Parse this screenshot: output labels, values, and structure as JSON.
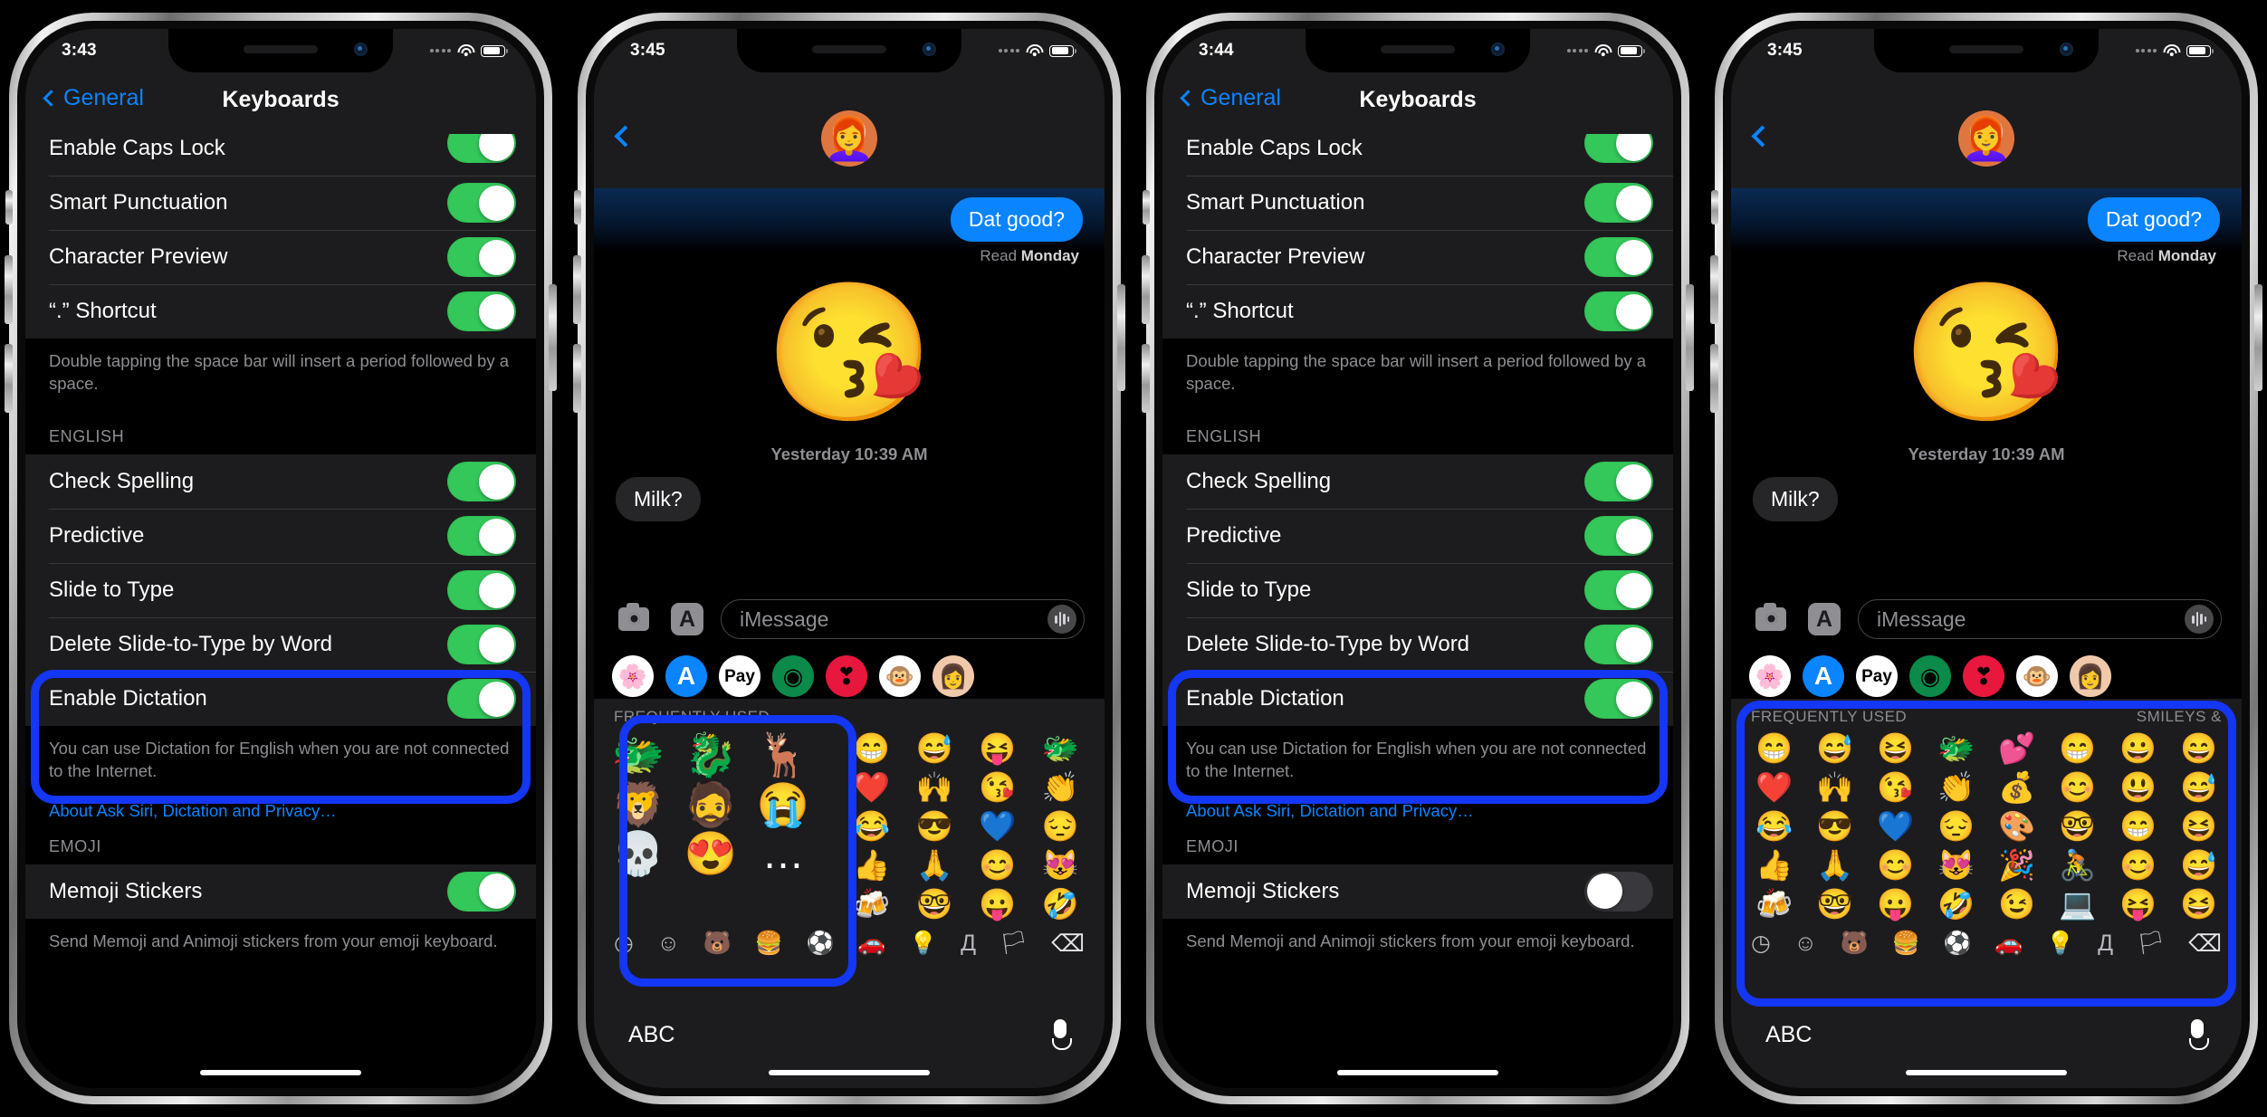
{
  "phones": [
    {
      "id": "phone-settings-on",
      "type": "settings",
      "status": {
        "time": "3:43",
        "signal_dots": 4,
        "wifi": "wifi-icon",
        "battery": "battery-icon"
      },
      "nav": {
        "back_label": "General",
        "title": "Keyboards"
      },
      "rows_top": [
        {
          "label": "Enable Caps Lock",
          "toggle": "on"
        },
        {
          "label": "Smart Punctuation",
          "toggle": "on"
        },
        {
          "label": "Character Preview",
          "toggle": "on"
        },
        {
          "label": "“.” Shortcut",
          "toggle": "on"
        }
      ],
      "footnote_top": "Double tapping the space bar will insert a period followed by a space.",
      "english_header": "ENGLISH",
      "rows_english": [
        {
          "label": "Check Spelling",
          "toggle": "on"
        },
        {
          "label": "Predictive",
          "toggle": "on"
        },
        {
          "label": "Slide to Type",
          "toggle": "on"
        },
        {
          "label": "Delete Slide-to-Type by Word",
          "toggle": "on"
        },
        {
          "label": "Enable Dictation",
          "toggle": "on"
        }
      ],
      "footnote_dictation": "You can use Dictation for English when you are not connected to the Internet.",
      "privacy_link": "About Ask Siri, Dictation and Privacy…",
      "emoji_header": "EMOJI",
      "memoji_row": {
        "label": "Memoji Stickers",
        "toggle": "on"
      },
      "memoji_footnote": "Send Memoji and Animoji stickers from your emoji keyboard.",
      "highlight": true
    },
    {
      "id": "phone-messages-memoji-on",
      "type": "messages",
      "status": {
        "time": "3:45",
        "signal_dots": 4,
        "wifi": "wifi-icon",
        "battery": "battery-icon"
      },
      "nav": {
        "back_icon": "chevron-left-icon",
        "avatar_emoji": "👩‍🦰"
      },
      "thread": [
        {
          "side": "out",
          "text": "Dat good?"
        }
      ],
      "read_prefix": "Read ",
      "read_value": "Monday",
      "sticker_emoji": "😘",
      "daystamp": "Yesterday 10:39 AM",
      "incoming": {
        "side": "in",
        "text": "Milk?"
      },
      "input": {
        "placeholder": "iMessage",
        "camera_icon": "camera-icon",
        "appstore_icon": "app-store-icon",
        "audio_icon": "audio-waveform-icon"
      },
      "app_drawer": [
        "photos-app-icon",
        "app-store-icon",
        "apple-pay-icon",
        "images-app-icon",
        "music-app-icon",
        "animoji-app-icon",
        "memoji-app-icon"
      ],
      "app_drawer_glyphs": [
        "🌺",
        "A",
        " Pay",
        "◉",
        "❣",
        "🐵",
        "👩"
      ],
      "keyboard": {
        "section_left": "FREQUENTLY USED",
        "section_right": "",
        "sticker_highlight": true,
        "stickers": [
          "🐲",
          "🐉",
          "🦌",
          "🦁",
          "🧔",
          "😭",
          "💀",
          "😍",
          "…"
        ],
        "emoji_rows": [
          [
            "😁",
            "😅",
            "😝",
            "🐲"
          ],
          [
            "❤️",
            "🙌",
            "😘",
            "👏"
          ],
          [
            "😂",
            "😎",
            "💙",
            "😔"
          ],
          [
            "👍",
            "🙏",
            "😊",
            "😻"
          ],
          [
            "🍻",
            "🤓",
            "😛",
            "🤣"
          ]
        ],
        "bottom_icons": [
          "recents-icon",
          "smileys-icon",
          "animals-icon",
          "food-icon",
          "activity-icon",
          "travel-icon",
          "objects-icon",
          "symbols-icon",
          "flags-icon",
          "backspace-icon"
        ],
        "bottom_glyphs": [
          "◷",
          "☺",
          "🐻",
          "🍔",
          "⚽",
          "🚗",
          "💡",
          "Д",
          "🏳",
          "⌫"
        ],
        "abc_label": "ABC",
        "mic_icon": "microphone-icon"
      }
    },
    {
      "id": "phone-settings-off",
      "type": "settings",
      "status": {
        "time": "3:44",
        "signal_dots": 4,
        "wifi": "wifi-icon",
        "battery": "battery-icon"
      },
      "nav": {
        "back_label": "General",
        "title": "Keyboards"
      },
      "rows_top": [
        {
          "label": "Enable Caps Lock",
          "toggle": "on"
        },
        {
          "label": "Smart Punctuation",
          "toggle": "on"
        },
        {
          "label": "Character Preview",
          "toggle": "on"
        },
        {
          "label": "“.” Shortcut",
          "toggle": "on"
        }
      ],
      "footnote_top": "Double tapping the space bar will insert a period followed by a space.",
      "english_header": "ENGLISH",
      "rows_english": [
        {
          "label": "Check Spelling",
          "toggle": "on"
        },
        {
          "label": "Predictive",
          "toggle": "on"
        },
        {
          "label": "Slide to Type",
          "toggle": "on"
        },
        {
          "label": "Delete Slide-to-Type by Word",
          "toggle": "on"
        },
        {
          "label": "Enable Dictation",
          "toggle": "on"
        }
      ],
      "footnote_dictation": "You can use Dictation for English when you are not connected to the Internet.",
      "privacy_link": "About Ask Siri, Dictation and Privacy…",
      "emoji_header": "EMOJI",
      "memoji_row": {
        "label": "Memoji Stickers",
        "toggle": "off"
      },
      "memoji_footnote": "Send Memoji and Animoji stickers from your emoji keyboard.",
      "highlight": true
    },
    {
      "id": "phone-messages-memoji-off",
      "type": "messages",
      "status": {
        "time": "3:45",
        "signal_dots": 4,
        "wifi": "wifi-icon",
        "battery": "battery-icon"
      },
      "nav": {
        "back_icon": "chevron-left-icon",
        "avatar_emoji": "👩‍🦰"
      },
      "thread": [
        {
          "side": "out",
          "text": "Dat good?"
        }
      ],
      "read_prefix": "Read ",
      "read_value": "Monday",
      "sticker_emoji": "😘",
      "daystamp": "Yesterday 10:39 AM",
      "incoming": {
        "side": "in",
        "text": "Milk?"
      },
      "input": {
        "placeholder": "iMessage",
        "camera_icon": "camera-icon",
        "appstore_icon": "app-store-icon",
        "audio_icon": "audio-waveform-icon"
      },
      "app_drawer": [
        "photos-app-icon",
        "app-store-icon",
        "apple-pay-icon",
        "images-app-icon",
        "music-app-icon",
        "animoji-app-icon",
        "memoji-app-icon"
      ],
      "app_drawer_glyphs": [
        "🌺",
        "A",
        " Pay",
        "◉",
        "❣",
        "🐵",
        "👩"
      ],
      "keyboard": {
        "section_left": "FREQUENTLY USED",
        "section_right": "SMILEYS &",
        "sticker_highlight": false,
        "emoji_rows": [
          [
            "😁",
            "😅",
            "😆",
            "🐲",
            "💕",
            "😁",
            "😀",
            "😄"
          ],
          [
            "❤️",
            "🙌",
            "😘",
            "👏",
            "💰",
            "😊",
            "😃",
            "😅"
          ],
          [
            "😂",
            "😎",
            "💙",
            "😔",
            "🎨",
            "🤓",
            "😁",
            "😆"
          ],
          [
            "👍",
            "🙏",
            "😊",
            "😻",
            "🎉",
            "🚴",
            "😊",
            "😅"
          ],
          [
            "🍻",
            "🤓",
            "😛",
            "🤣",
            "😉",
            "💻",
            "😝",
            "😆"
          ]
        ],
        "bottom_icons": [
          "recents-icon",
          "smileys-icon",
          "animals-icon",
          "food-icon",
          "activity-icon",
          "travel-icon",
          "objects-icon",
          "symbols-icon",
          "flags-icon",
          "backspace-icon"
        ],
        "bottom_glyphs": [
          "◷",
          "☺",
          "🐻",
          "🍔",
          "⚽",
          "🚗",
          "💡",
          "Д",
          "🏳",
          "⌫"
        ],
        "abc_label": "ABC",
        "mic_icon": "microphone-icon",
        "keyboard_highlight": true
      }
    }
  ],
  "colors": {
    "accent_blue": "#0a84ff",
    "highlight_blue": "#1436f5",
    "toggle_on": "#34c759",
    "toggle_off": "#39393d",
    "panel": "#1c1c1e",
    "secondary_text": "#8e8e93"
  }
}
